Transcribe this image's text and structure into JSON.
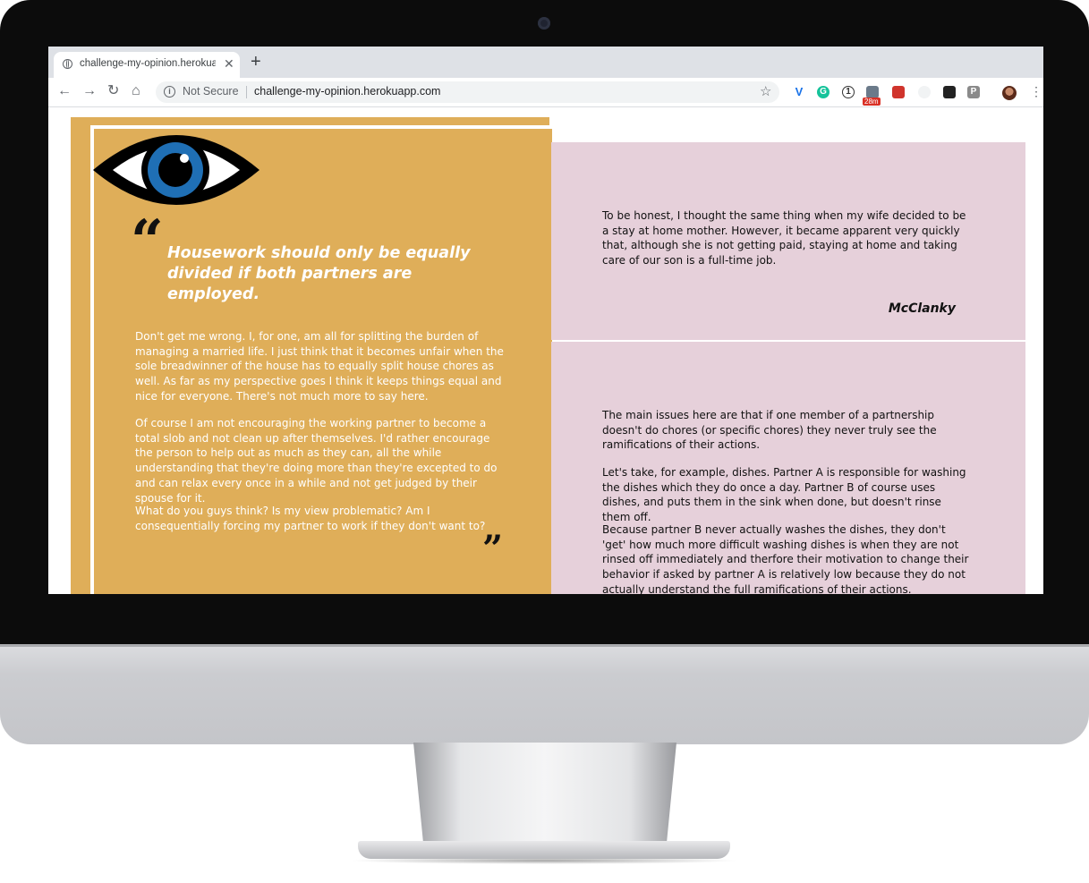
{
  "browser": {
    "tab_title": "challenge-my-opinion.herokuapp.com",
    "new_tab": "+",
    "security_label": "Not Secure",
    "url": "challenge-my-opinion.herokuapp.com",
    "extension_badge": "28m"
  },
  "left_card": {
    "quote_title": "Housework should only be equally divided if both partners are employed.",
    "open_quote": "“",
    "close_quote": "”",
    "paragraphs": [
      "Don't get me wrong. I, for one, am all for splitting the burden of managing a married life. I just think that it becomes unfair when the sole breadwinner of the house has to equally split house chores as well. As far as my perspective goes I think it keeps things equal and nice for everyone. There's not much more to say here.",
      "Of course I am not encouraging the working partner to become a total slob and not clean up after themselves. I'd rather encourage the person to help out as much as they can, all the while understanding that they're doing more than they're excepted to do and can relax every once in a while and not get judged by their spouse for it.",
      "What do you guys think? Is my view problematic? Am I consequentially forcing my partner to work if they don't want to?"
    ],
    "colors": {
      "card": "#dfae59",
      "text": "#ffffff"
    }
  },
  "comments": [
    {
      "text": "To be honest, I thought the same thing when my wife decided to be a stay at home mother. However, it became apparent very quickly that, although she is not getting paid, staying at home and taking care of our son is a full-time job.",
      "author": "McClanky"
    },
    {
      "paragraphs": [
        "The main issues here are that if one member of a partnership doesn't do chores (or specific chores) they never truly see the ramifications of their actions.",
        "Let's take, for example, dishes. Partner A is responsible for washing the dishes which they do once a day. Partner B of course uses dishes, and puts them in the sink when done, but doesn't rinse them off.",
        "Because partner B never actually washes the dishes, they don't 'get' how much more difficult washing dishes is when they are not rinsed off immediately and therfore their motivation to change their behavior if asked by partner A is relatively low because they do not actually understand the full ramifications of their actions."
      ]
    }
  ],
  "colors": {
    "comment_bg": "#e6d0da",
    "eye_iris": "#1f6fb5"
  }
}
